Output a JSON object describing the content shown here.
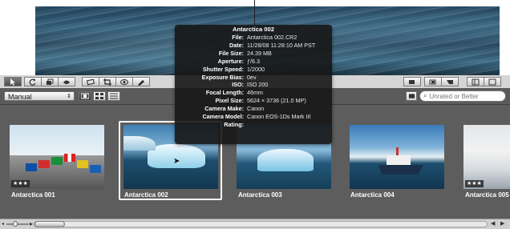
{
  "viewer": {
    "image_name": "Antarctica 002"
  },
  "hud": {
    "title": "Antarctica 002",
    "rows": [
      {
        "key": "File:",
        "value": "Antarctica 002.CR2"
      },
      {
        "key": "Date:",
        "value": "11/28/08 11:28:10 AM PST"
      },
      {
        "key": "File Size:",
        "value": "24.39 MB"
      },
      {
        "key": "Aperture:",
        "value": "ƒ/6.3"
      },
      {
        "key": "Shutter Speed:",
        "value": "1/2000"
      },
      {
        "key": "Exposure Bias:",
        "value": "0ev"
      },
      {
        "key": "ISO:",
        "value": "ISO 200"
      },
      {
        "key": "Focal Length:",
        "value": "46mm"
      },
      {
        "key": "Pixel Size:",
        "value": "5624 × 3736 (21.0 MP)"
      },
      {
        "key": "Camera Make:",
        "value": "Canon"
      },
      {
        "key": "Camera Model:",
        "value": "Canon EOS-1Ds Mark III"
      },
      {
        "key": "Rating:",
        "value": ""
      }
    ]
  },
  "toolbar": {
    "left_tools": [
      "select-tool",
      "rotate-tool",
      "stack-tool",
      "lift-tool"
    ],
    "edit_tools": [
      "straighten-tool",
      "crop-tool",
      "red-eye-tool",
      "spot-patch-tool"
    ],
    "right_tools": [
      "tool-a",
      "tool-b",
      "tool-c",
      "tool-d",
      "tool-e"
    ]
  },
  "browser_controls": {
    "sort_select": "Manual",
    "search_placeholder": "Unrated or Better"
  },
  "thumbnails": [
    {
      "label": "Antarctica 001",
      "stars": "★★★"
    },
    {
      "label": "Antarctica 002",
      "stars": ""
    },
    {
      "label": "Antarctica 003",
      "stars": ""
    },
    {
      "label": "Antarctica 004",
      "stars": ""
    },
    {
      "label": "Antarctica 005",
      "stars": "★★★"
    }
  ]
}
